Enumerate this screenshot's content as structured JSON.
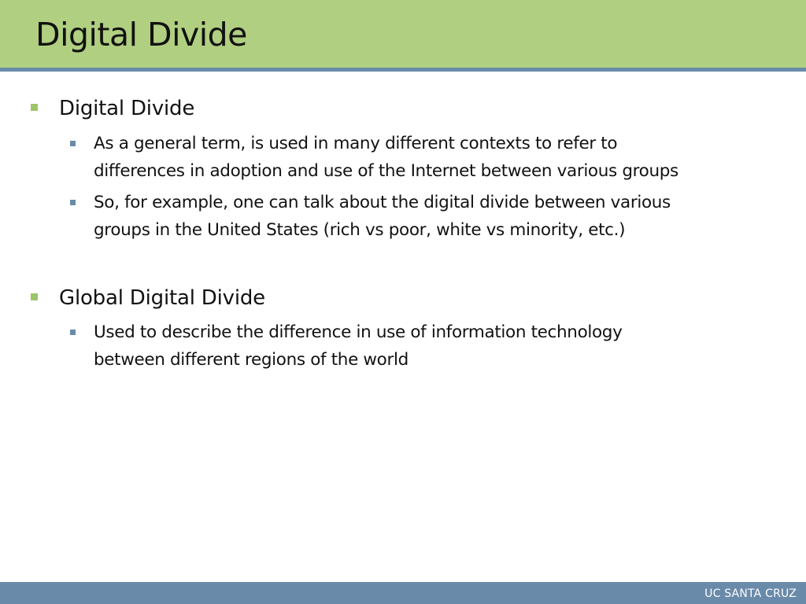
{
  "slide": {
    "title": "Digital Divide",
    "footer": "UC SANTA CRUZ",
    "colors": {
      "title_bar": "#b0cf80",
      "accent_blue": "#6a8aaa",
      "level1_bullet": "#9ec46a",
      "text": "#111111"
    }
  },
  "bullets": [
    {
      "text": "Digital Divide",
      "subitems": [
        {
          "lines": [
            "As a general term, is used in many different contexts to refer to",
            "differences in adoption and use of the Internet between various groups"
          ]
        },
        {
          "lines": [
            "So, for example, one can talk about the digital divide between various",
            "groups in the United States (rich vs poor, white vs minority, etc.)"
          ]
        }
      ]
    },
    {
      "text": "Global Digital Divide",
      "subitems": [
        {
          "lines": [
            "Used to describe the difference in use of information technology",
            "between different regions of the world"
          ]
        }
      ]
    }
  ]
}
